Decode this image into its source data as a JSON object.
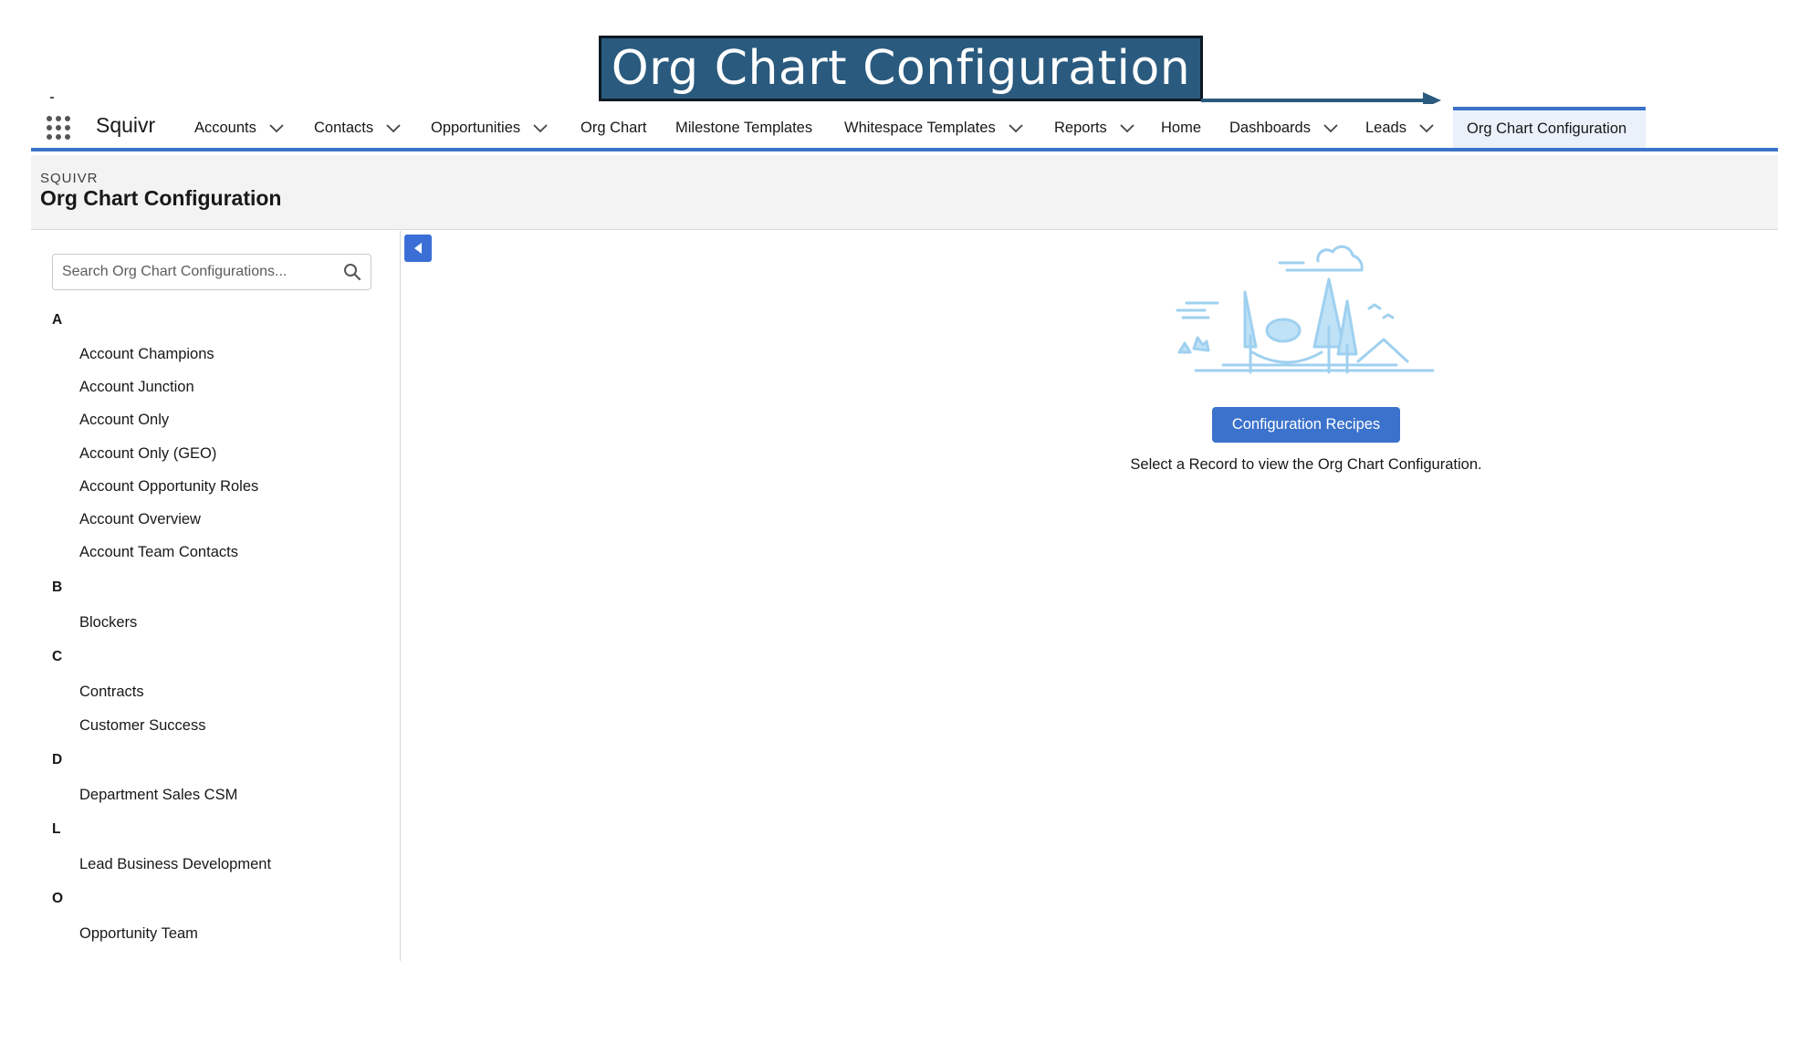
{
  "callout": {
    "title": "Org Chart Configuration"
  },
  "app": {
    "name": "Squivr",
    "nav": [
      {
        "label": "Accounts"
      },
      {
        "label": "Contacts"
      },
      {
        "label": "Opportunities"
      },
      {
        "label": "Org Chart"
      },
      {
        "label": "Milestone Templates"
      },
      {
        "label": "Whitespace Templates"
      },
      {
        "label": "Reports"
      },
      {
        "label": "Home"
      },
      {
        "label": "Dashboards"
      },
      {
        "label": "Leads"
      }
    ],
    "active_tab": "Org Chart Configuration"
  },
  "header": {
    "eyebrow": "SQUIVR",
    "title": "Org Chart Configuration"
  },
  "sidebar": {
    "search_placeholder": "Search Org Chart Configurations...",
    "groups": [
      {
        "letter": "A",
        "items": [
          "Account Champions",
          "Account Junction",
          "Account Only",
          "Account Only (GEO)",
          "Account Opportunity Roles",
          "Account Overview",
          "Account Team Contacts"
        ]
      },
      {
        "letter": "B",
        "items": [
          "Blockers"
        ]
      },
      {
        "letter": "C",
        "items": [
          "Contracts",
          "Customer Success"
        ]
      },
      {
        "letter": "D",
        "items": [
          "Department Sales CSM"
        ]
      },
      {
        "letter": "L",
        "items": [
          "Lead Business Development"
        ]
      },
      {
        "letter": "O",
        "items": [
          "Opportunity Team"
        ]
      }
    ]
  },
  "main": {
    "button_label": "Configuration Recipes",
    "empty_message": "Select a Record to view the Org Chart Configuration."
  },
  "colors": {
    "brand_blue": "#3b72cc",
    "callout_bg": "#2a5a7e",
    "illustration": "#9fd0f0"
  }
}
